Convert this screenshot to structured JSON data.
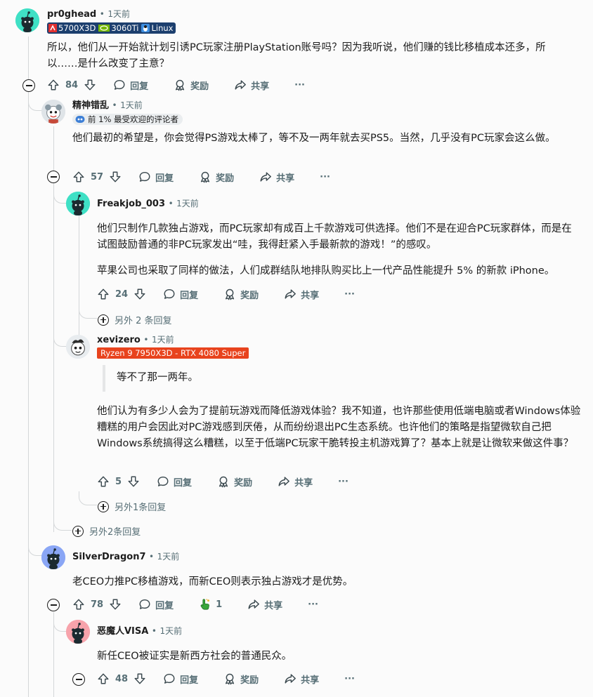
{
  "comments": [
    {
      "user": "pr0ghead",
      "time": "1天前",
      "flair": [
        "5700X3D",
        "3060Ti",
        "Linux"
      ],
      "body": "所以，他们从一开始就计划引诱PC玩家注册PlayStation账号吗？因为我听说，他们赚的钱比移植成本还多，所以……是什么改变了主意？",
      "votes": "84"
    },
    {
      "user": "精神错乱",
      "time": "1天前",
      "flair": "前 1% 最受欢迎的评论者",
      "body": "他们最初的希望是，你会觉得PS游戏太棒了，等不及一两年就去买PS5。当然，几乎没有PC玩家会这么做。",
      "votes": "57"
    },
    {
      "user": "Freakjob_003",
      "time": "1天前",
      "body1": "他们只制作几款独占游戏，而PC玩家却有成百上千款游戏可供选择。他们不是在迎合PC玩家群体，而是在试图鼓励普通的非PC玩家发出“哇，我得赶紧入手最新款的游戏！”的感叹。",
      "body2": "苹果公司也采取了同样的做法，人们成群结队地排队购买比上一代产品性能提升 5% 的新款 iPhone。",
      "votes": "24",
      "more": "另外 2 条回复"
    },
    {
      "user": "xevizero",
      "time": "1天前",
      "flair": "Ryzen 9 7950X3D - RTX 4080 Super",
      "quote": "等不了那一两年。",
      "body": "他们认为有多少人会为了提前玩游戏而降低游戏体验？我不知道，也许那些使用低端电脑或者Windows体验糟糕的用户会因此对PC游戏感到厌倦，从而纷纷退出PC生态系统。也许他们的策略是指望微软自己把Windows系统搞得这么糟糕，以至于低端PC玩家干脆转投主机游戏算了？基本上就是让微软来做这件事？",
      "votes": "5",
      "more": "另外1条回复"
    },
    {
      "more": "另外2条回复"
    },
    {
      "user": "SilverDragon7",
      "time": "1天前",
      "body": "老CEO力推PC移植游戏，而新CEO则表示独占游戏才是优势。",
      "votes": "78",
      "award_count": "1"
    },
    {
      "user": "恶魔人VISA",
      "time": "1天前",
      "body": "新任CEO被证实是新西方社会的普通民众。",
      "votes": "48"
    }
  ],
  "labels": {
    "reply": "回复",
    "award": "奖励",
    "share": "共享",
    "more": "···",
    "dot": "•"
  },
  "colors": {
    "muted": "#576f76",
    "thread_line": "#d4d7d9",
    "flair_dark": "#1c3f6e",
    "flair_red": "#e8431d"
  }
}
